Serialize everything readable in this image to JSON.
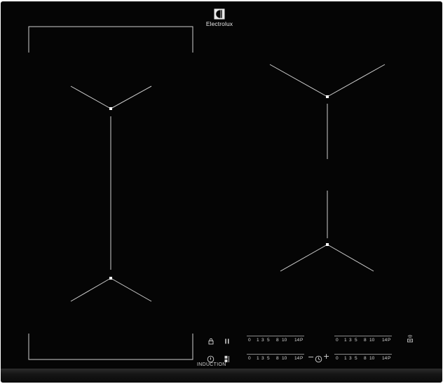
{
  "brand": {
    "name": "Electrolux"
  },
  "controls": {
    "lock_icon": "lock-icon",
    "pause_icon": "pause-icon",
    "timer_icon": "timer-icon",
    "bridge_icon": "bridge-icon",
    "minus_symbol": "−",
    "timer_symbol": "◷",
    "plus_symbol": "+",
    "induction_label": "INDUCTION",
    "hob2hood_icon": "hob2hood-icon"
  },
  "power_scale_labels": [
    "0",
    "1",
    "3",
    "5",
    "8",
    "10",
    "14",
    "P"
  ],
  "power_scales": [
    {
      "name": "zone-front-left",
      "labels": [
        "0",
        "1",
        "3",
        "5",
        "8",
        "10",
        "14",
        "P"
      ]
    },
    {
      "name": "zone-rear-left",
      "labels": [
        "0",
        "1",
        "3",
        "5",
        "8",
        "10",
        "14",
        "P"
      ]
    },
    {
      "name": "zone-front-right",
      "labels": [
        "0",
        "1",
        "3",
        "5",
        "8",
        "10",
        "14",
        "P"
      ]
    },
    {
      "name": "zone-rear-right",
      "labels": [
        "0",
        "1",
        "3",
        "5",
        "8",
        "10",
        "14",
        "P"
      ]
    }
  ],
  "colors": {
    "glass": "#050505",
    "markings": "#cfcfcf",
    "zone_center": "#ffffff"
  }
}
